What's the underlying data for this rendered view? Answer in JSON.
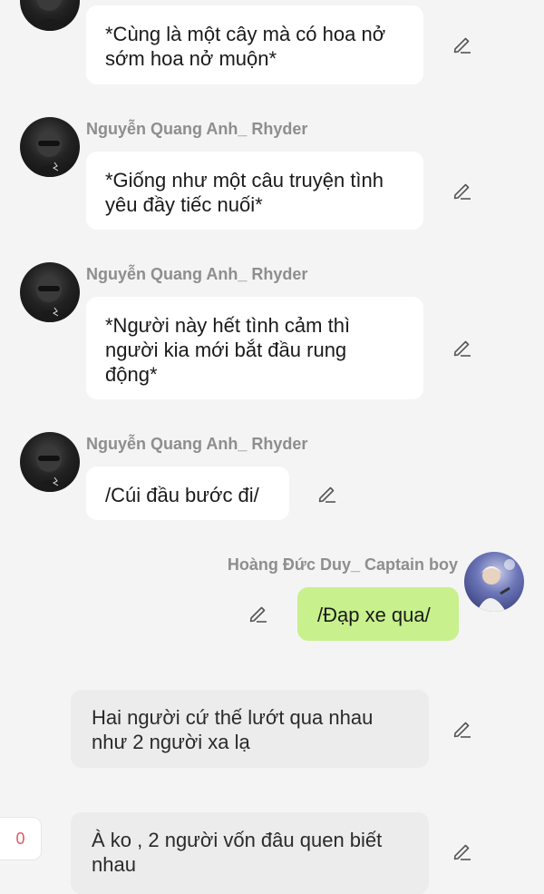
{
  "messages": [
    {
      "speaker": "",
      "text": "*Cùng là một cây mà có hoa nở sớm hoa nở muộn*"
    },
    {
      "speaker": "Nguyễn Quang Anh_ Rhyder",
      "text": "*Giống như một câu truyện tình yêu đầy tiếc nuối*"
    },
    {
      "speaker": "Nguyễn Quang Anh_ Rhyder",
      "text": "*Người này hết tình cảm thì người kia mới bắt đầu rung động*"
    },
    {
      "speaker": "Nguyễn Quang Anh_ Rhyder",
      "text": "/Cúi đầu bước đi/"
    },
    {
      "speaker": "Hoàng Đức Duy_ Captain boy",
      "text": "/Đạp xe qua/"
    }
  ],
  "narrations": [
    {
      "text": "Hai người cứ thế lướt qua nhau như 2 người xa lạ"
    },
    {
      "text": "À ko , 2 người vốn đâu quen biết nhau"
    }
  ],
  "comment_badge": {
    "count": "0"
  },
  "colors": {
    "background": "#f4f4f4",
    "bubble": "#ffffff",
    "own_bubble": "#c8f08c",
    "narration_bubble": "#ececec",
    "name": "#8e8e8e",
    "badge_text": "#e05a6a"
  },
  "icons": {
    "edit": "pencil-icon",
    "avatar_left": "avatar",
    "avatar_right": "avatar"
  }
}
